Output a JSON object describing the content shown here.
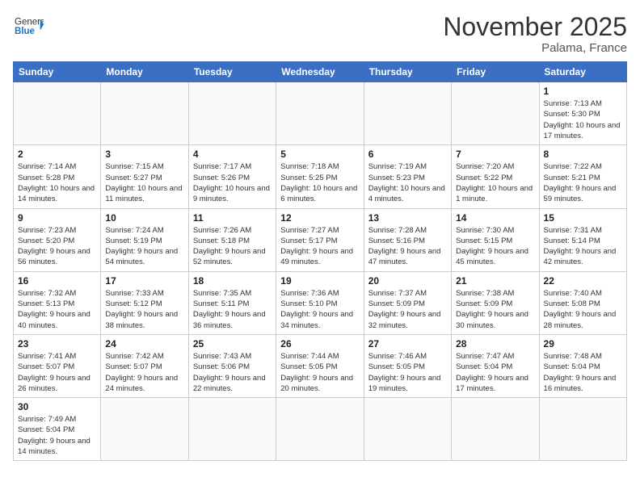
{
  "header": {
    "logo_general": "General",
    "logo_blue": "Blue",
    "month_year": "November 2025",
    "location": "Palama, France"
  },
  "weekdays": [
    "Sunday",
    "Monday",
    "Tuesday",
    "Wednesday",
    "Thursday",
    "Friday",
    "Saturday"
  ],
  "weeks": [
    [
      {
        "day": "",
        "info": ""
      },
      {
        "day": "",
        "info": ""
      },
      {
        "day": "",
        "info": ""
      },
      {
        "day": "",
        "info": ""
      },
      {
        "day": "",
        "info": ""
      },
      {
        "day": "",
        "info": ""
      },
      {
        "day": "1",
        "info": "Sunrise: 7:13 AM\nSunset: 5:30 PM\nDaylight: 10 hours and 17 minutes."
      }
    ],
    [
      {
        "day": "2",
        "info": "Sunrise: 7:14 AM\nSunset: 5:28 PM\nDaylight: 10 hours and 14 minutes."
      },
      {
        "day": "3",
        "info": "Sunrise: 7:15 AM\nSunset: 5:27 PM\nDaylight: 10 hours and 11 minutes."
      },
      {
        "day": "4",
        "info": "Sunrise: 7:17 AM\nSunset: 5:26 PM\nDaylight: 10 hours and 9 minutes."
      },
      {
        "day": "5",
        "info": "Sunrise: 7:18 AM\nSunset: 5:25 PM\nDaylight: 10 hours and 6 minutes."
      },
      {
        "day": "6",
        "info": "Sunrise: 7:19 AM\nSunset: 5:23 PM\nDaylight: 10 hours and 4 minutes."
      },
      {
        "day": "7",
        "info": "Sunrise: 7:20 AM\nSunset: 5:22 PM\nDaylight: 10 hours and 1 minute."
      },
      {
        "day": "8",
        "info": "Sunrise: 7:22 AM\nSunset: 5:21 PM\nDaylight: 9 hours and 59 minutes."
      }
    ],
    [
      {
        "day": "9",
        "info": "Sunrise: 7:23 AM\nSunset: 5:20 PM\nDaylight: 9 hours and 56 minutes."
      },
      {
        "day": "10",
        "info": "Sunrise: 7:24 AM\nSunset: 5:19 PM\nDaylight: 9 hours and 54 minutes."
      },
      {
        "day": "11",
        "info": "Sunrise: 7:26 AM\nSunset: 5:18 PM\nDaylight: 9 hours and 52 minutes."
      },
      {
        "day": "12",
        "info": "Sunrise: 7:27 AM\nSunset: 5:17 PM\nDaylight: 9 hours and 49 minutes."
      },
      {
        "day": "13",
        "info": "Sunrise: 7:28 AM\nSunset: 5:16 PM\nDaylight: 9 hours and 47 minutes."
      },
      {
        "day": "14",
        "info": "Sunrise: 7:30 AM\nSunset: 5:15 PM\nDaylight: 9 hours and 45 minutes."
      },
      {
        "day": "15",
        "info": "Sunrise: 7:31 AM\nSunset: 5:14 PM\nDaylight: 9 hours and 42 minutes."
      }
    ],
    [
      {
        "day": "16",
        "info": "Sunrise: 7:32 AM\nSunset: 5:13 PM\nDaylight: 9 hours and 40 minutes."
      },
      {
        "day": "17",
        "info": "Sunrise: 7:33 AM\nSunset: 5:12 PM\nDaylight: 9 hours and 38 minutes."
      },
      {
        "day": "18",
        "info": "Sunrise: 7:35 AM\nSunset: 5:11 PM\nDaylight: 9 hours and 36 minutes."
      },
      {
        "day": "19",
        "info": "Sunrise: 7:36 AM\nSunset: 5:10 PM\nDaylight: 9 hours and 34 minutes."
      },
      {
        "day": "20",
        "info": "Sunrise: 7:37 AM\nSunset: 5:09 PM\nDaylight: 9 hours and 32 minutes."
      },
      {
        "day": "21",
        "info": "Sunrise: 7:38 AM\nSunset: 5:09 PM\nDaylight: 9 hours and 30 minutes."
      },
      {
        "day": "22",
        "info": "Sunrise: 7:40 AM\nSunset: 5:08 PM\nDaylight: 9 hours and 28 minutes."
      }
    ],
    [
      {
        "day": "23",
        "info": "Sunrise: 7:41 AM\nSunset: 5:07 PM\nDaylight: 9 hours and 26 minutes."
      },
      {
        "day": "24",
        "info": "Sunrise: 7:42 AM\nSunset: 5:07 PM\nDaylight: 9 hours and 24 minutes."
      },
      {
        "day": "25",
        "info": "Sunrise: 7:43 AM\nSunset: 5:06 PM\nDaylight: 9 hours and 22 minutes."
      },
      {
        "day": "26",
        "info": "Sunrise: 7:44 AM\nSunset: 5:05 PM\nDaylight: 9 hours and 20 minutes."
      },
      {
        "day": "27",
        "info": "Sunrise: 7:46 AM\nSunset: 5:05 PM\nDaylight: 9 hours and 19 minutes."
      },
      {
        "day": "28",
        "info": "Sunrise: 7:47 AM\nSunset: 5:04 PM\nDaylight: 9 hours and 17 minutes."
      },
      {
        "day": "29",
        "info": "Sunrise: 7:48 AM\nSunset: 5:04 PM\nDaylight: 9 hours and 16 minutes."
      }
    ],
    [
      {
        "day": "30",
        "info": "Sunrise: 7:49 AM\nSunset: 5:04 PM\nDaylight: 9 hours and 14 minutes."
      },
      {
        "day": "",
        "info": ""
      },
      {
        "day": "",
        "info": ""
      },
      {
        "day": "",
        "info": ""
      },
      {
        "day": "",
        "info": ""
      },
      {
        "day": "",
        "info": ""
      },
      {
        "day": "",
        "info": ""
      }
    ]
  ]
}
